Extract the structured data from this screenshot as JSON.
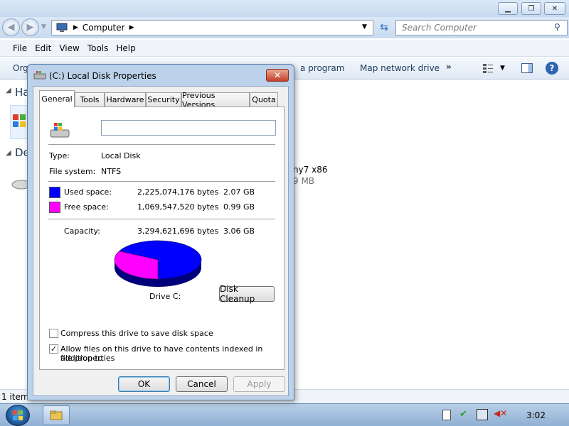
{
  "explorer": {
    "address_segment": "Computer",
    "search_placeholder": "Search Computer",
    "menu": [
      "File",
      "Edit",
      "View",
      "Tools",
      "Help"
    ],
    "toolbar_org_partial": "Org",
    "toolbar_items": [
      "a program",
      "Map network drive"
    ],
    "overflow_glyph": "»",
    "group_hard_drives_partial": "Ha",
    "group_devices_partial": "De",
    "drive_name_partial": "ny7 x86",
    "drive_size_partial": "9 MB",
    "status_text": "1 item"
  },
  "taskbar": {
    "clock": "3:02"
  },
  "dialog": {
    "title": "(C:) Local Disk Properties",
    "tabs": [
      "General",
      "Tools",
      "Hardware",
      "Security",
      "Previous Versions",
      "Quota"
    ],
    "active_tab": "General",
    "label_value": "",
    "type_label": "Type:",
    "type_value": "Local Disk",
    "fs_label": "File system:",
    "fs_value": "NTFS",
    "used": {
      "label": "Used space:",
      "bytes": "2,225,074,176 bytes",
      "size": "2.07 GB",
      "color": "#0000ff"
    },
    "free": {
      "label": "Free space:",
      "bytes": "1,069,547,520 bytes",
      "size": "0.99 GB",
      "color": "#ff00ff"
    },
    "capacity": {
      "label": "Capacity:",
      "bytes": "3,294,621,696 bytes",
      "size": "3.06 GB"
    },
    "used_fraction": 0.675,
    "drive_caption": "Drive C:",
    "cleanup_button": "Disk Cleanup",
    "compress_label": "Compress this drive to save disk space",
    "compress_checked": false,
    "index_label_line1": "Allow files on this drive to have contents indexed in addition to",
    "index_label_line2": "file properties",
    "index_checked": true,
    "ok_button": "OK",
    "cancel_button": "Cancel",
    "apply_button": "Apply"
  }
}
